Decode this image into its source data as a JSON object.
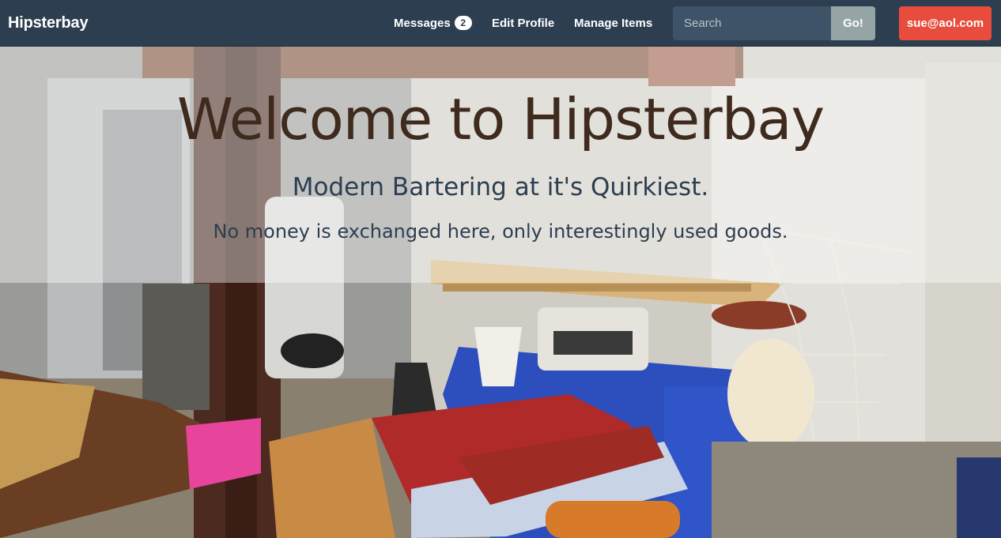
{
  "navbar": {
    "brand": "Hipsterbay",
    "messages_label": "Messages",
    "messages_count": "2",
    "edit_profile_label": "Edit Profile",
    "manage_items_label": "Manage Items",
    "search_placeholder": "Search",
    "search_button_label": "Go!",
    "user_email": "sue@aol.com"
  },
  "hero": {
    "title": "Welcome to Hipsterbay",
    "subtitle": "Modern Bartering at it's Quirkiest.",
    "tagline": "No money is exchanged here, only interestingly used goods.",
    "background_image": "basement-vintage-goods-photo"
  },
  "colors": {
    "navbar_bg": "#2c3e50",
    "search_bg": "#3e5368",
    "go_button": "#95a5a6",
    "user_button": "#e74c3c",
    "title_text": "#3f2a1e",
    "subtitle_text": "#2c3e50"
  }
}
